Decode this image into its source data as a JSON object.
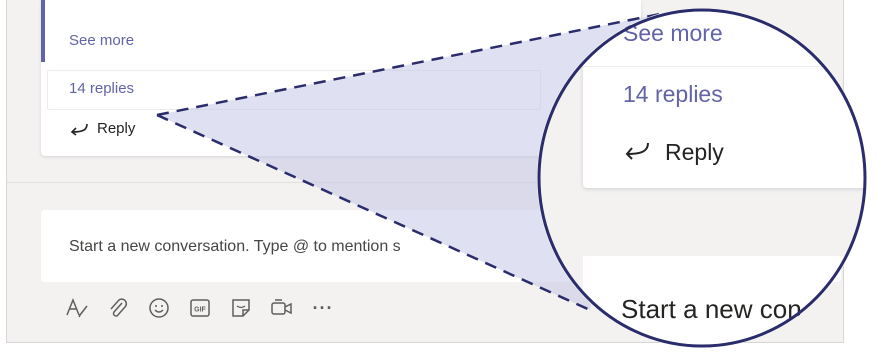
{
  "thread": {
    "see_more": "See more",
    "replies": "14 replies",
    "reply": "Reply"
  },
  "compose": {
    "placeholder": "Start a new conversation. Type @ to mention s"
  },
  "toolbar": {
    "icons": [
      "format-icon",
      "attach-icon",
      "emoji-icon",
      "gif-icon",
      "sticker-icon",
      "meet-now-icon",
      "more-options-icon"
    ],
    "gif_label": "GIF",
    "more_label": "···"
  },
  "magnifier": {
    "see_more": "See more",
    "replies": "14 replies",
    "reply": "Reply",
    "compose_text": "Start a new con"
  },
  "colors": {
    "accent": "#6264a7",
    "callout_outline": "#2b2c6b",
    "callout_fill": "#c5c6e6"
  }
}
